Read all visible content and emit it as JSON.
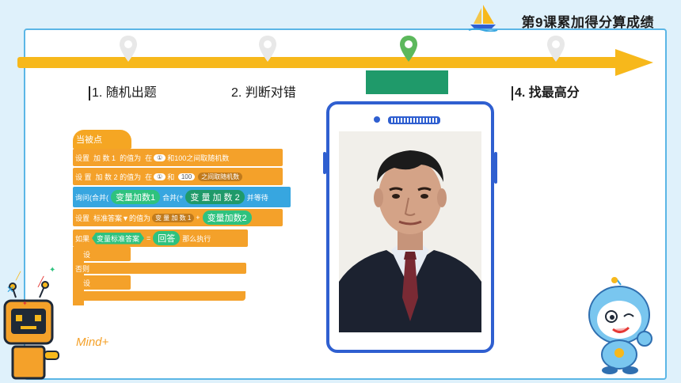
{
  "header": {
    "title": "第9课累加得分算成绩"
  },
  "timeline": {
    "steps": [
      {
        "label": "1. 随机出题"
      },
      {
        "label": "2. 判断对错"
      },
      {
        "label": ""
      },
      {
        "label": "4. 找最高分"
      }
    ]
  },
  "code": {
    "hat": "当被点",
    "line1": {
      "a": "设置",
      "b": "加 数 1",
      "c": "的值为",
      "d": "在",
      "e": "①",
      "f": "和100之间取随机数"
    },
    "line2": {
      "a": "设 置",
      "b": "加 数 2",
      "c": "的值为",
      "d": "在",
      "e": "①",
      "f": "和",
      "g": "100",
      "h": "之间取随机数"
    },
    "line3": {
      "a": "询问(",
      "b": "合并(",
      "c": "变量加数1",
      "d": "合并(",
      "e": "+",
      "f": "变 量 加 数 2",
      "g": "并等待"
    },
    "line4": {
      "a": "设置",
      "b": "标准答案▼的值为",
      "c": "变 量 加 数 1",
      "d": "+",
      "e": "变量加数2"
    },
    "line5": {
      "a": "如果",
      "b": "变量标准答案",
      "c": "=",
      "d": "回答",
      "e": "那么执行"
    },
    "line6": {
      "a": "设"
    },
    "line7": {
      "a": "否则"
    },
    "line8": {
      "a": "设"
    },
    "brand": "Mind+"
  },
  "colors": {
    "accent": "#f7b81b",
    "border": "#5bb6e6",
    "phone": "#2f5fd0",
    "block_orange": "#f4a12a",
    "block_blue": "#37a6e0",
    "block_green": "#2ec27e"
  },
  "icons": [
    "sailboat-icon",
    "location-pin-icon",
    "robot-mascot-icon",
    "cartoon-mascot-icon",
    "phone-speaker-icon"
  ]
}
